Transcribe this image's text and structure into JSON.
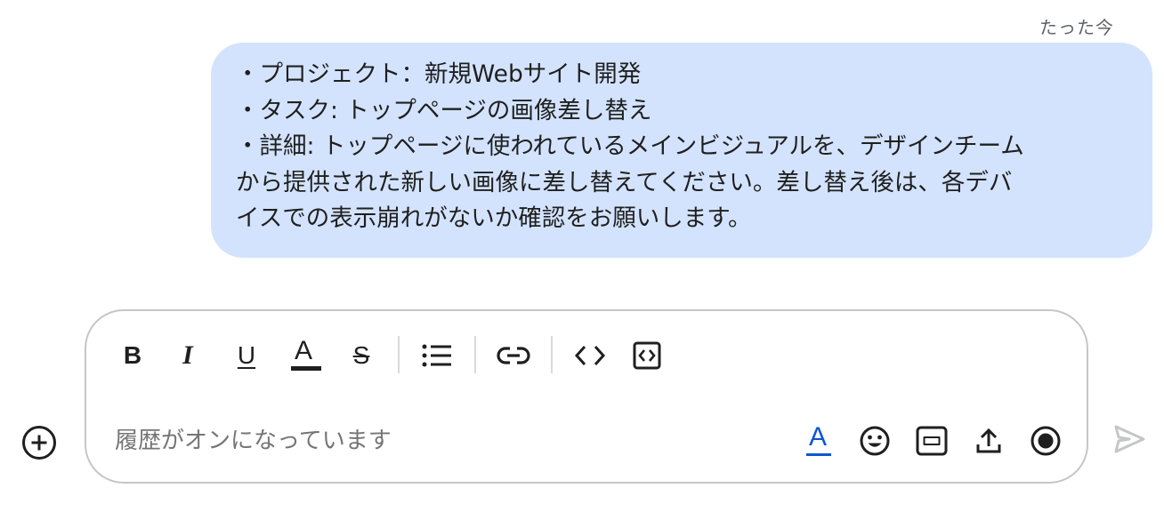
{
  "message": {
    "timestamp": "たった今",
    "lines": [
      "・プロジェクト：新規Webサイト開発",
      "・タスク: トップページの画像差し替え",
      "・詳細: トップページに使われているメインビジュアルを、デザインチーム",
      "から提供された新しい画像に差し替えてください。差し替え後は、各デバ",
      "イスでの表示崩れがないか確認をお願いします。"
    ]
  },
  "toolbar": {
    "bold": "B",
    "italic": "I",
    "underline": "U",
    "font_color": "A",
    "strikethrough": "S"
  },
  "composer": {
    "placeholder": "履歴がオンになっています",
    "value": "",
    "format_toggle": "A"
  },
  "icons": {
    "add": "plus-circle-icon",
    "bulleted_list": "bulleted-list-icon",
    "link": "link-icon",
    "code": "code-icon",
    "code_block": "code-block-icon",
    "emoji": "emoji-icon",
    "gif": "gif-icon",
    "upload": "upload-icon",
    "record": "record-icon",
    "send": "send-icon"
  },
  "colors": {
    "bubble_bg": "#d3e3fd",
    "accent": "#0b57d0",
    "send_disabled": "#c4c7c5"
  }
}
